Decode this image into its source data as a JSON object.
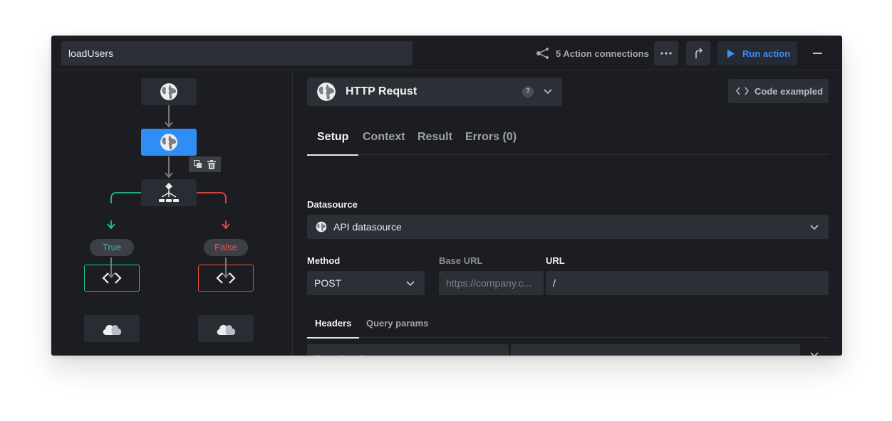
{
  "topbar": {
    "action_name": "loadUsers",
    "connections_label": "5 Action connections",
    "run_label": "Run action"
  },
  "flow": {
    "true_label": "True",
    "false_label": "False"
  },
  "config": {
    "request_type": "HTTP Requst",
    "help": "?",
    "code_button": "Code exampled",
    "tabs": [
      {
        "label": "Setup",
        "active": true
      },
      {
        "label": "Context",
        "active": false
      },
      {
        "label": "Result",
        "active": false
      },
      {
        "label": "Errors (0)",
        "active": false
      }
    ],
    "datasource": {
      "label": "Datasource",
      "value": "API datasource"
    },
    "method": {
      "label": "Method",
      "value": "POST"
    },
    "base_url": {
      "label": "Base URL",
      "placeholder": "https://company.c..."
    },
    "url": {
      "label": "URL",
      "value": "/"
    },
    "subtabs": [
      {
        "label": "Headers",
        "active": true
      },
      {
        "label": "Query params",
        "active": false
      }
    ],
    "header_row": {
      "name_placeholder": "Enter header name",
      "value": ""
    }
  },
  "colors": {
    "accent": "#2f8ef3",
    "run_text": "#3a8ff5",
    "true_green": "#20c185",
    "false_red": "#ec4a3d",
    "background": "#1c1d22",
    "surface": "#2d2f36"
  },
  "icons": {
    "connections": "connections-icon",
    "more": "more-icon",
    "deploy": "deploy-icon",
    "run": "play-icon",
    "minimize": "minimize-icon",
    "globe": "globe-icon",
    "branch": "branch-icon",
    "code": "code-icon",
    "cloud": "cloud-icon",
    "duplicate": "duplicate-icon",
    "delete": "trash-icon",
    "chevron": "chevron-down-icon",
    "close": "close-icon"
  }
}
